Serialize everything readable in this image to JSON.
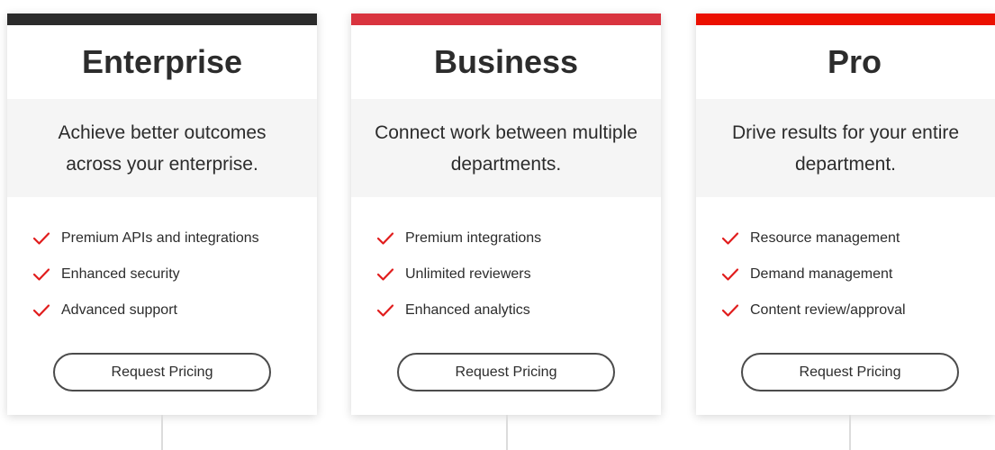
{
  "colors": {
    "enterprise_bar": "#2b2b2b",
    "business_bar": "#d9343f",
    "pro_bar": "#eb1000",
    "check": "#e11d1d"
  },
  "plans": [
    {
      "title": "Enterprise",
      "tagline": "Achieve better outcomes across your enterprise.",
      "features": [
        "Premium APIs and integrations",
        "Enhanced security",
        "Advanced support"
      ],
      "button_label": "Request Pricing"
    },
    {
      "title": "Business",
      "tagline": "Connect work between multiple departments.",
      "features": [
        "Premium integrations",
        "Unlimited reviewers",
        "Enhanced analytics"
      ],
      "button_label": "Request Pricing"
    },
    {
      "title": "Pro",
      "tagline": "Drive results for your entire department.",
      "features": [
        "Resource management",
        "Demand management",
        "Content review/approval"
      ],
      "button_label": "Request Pricing"
    }
  ],
  "icons": {
    "feature_check": "checkmark-icon"
  }
}
